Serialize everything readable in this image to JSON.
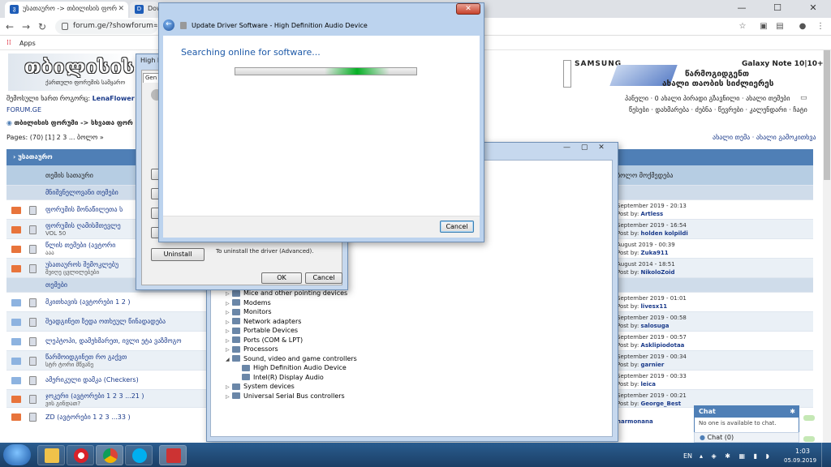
{
  "browser": {
    "tabs": [
      {
        "label": "უსათაურო -> თბილისის ფორ",
        "favicon": "ვ",
        "active": true
      },
      {
        "label": "Dow",
        "favicon": "D",
        "active": false
      }
    ],
    "url": "forum.ge/?showforum=25",
    "bookmarks_label": "Apps"
  },
  "site": {
    "logo": "თბილისის ფორუმი",
    "logo_sub": "ქართული ფორუმის სამყარო",
    "user_line_prefix": "შემოსული ხართ როგორც:",
    "username": "LenaFlower",
    "site_name": "FORUM.GE",
    "breadcrumb": "თბილისის ფორუმი -> სხვათა ფორ",
    "pages": "Pages: (70) [1] 2 3 ... ბოლო »",
    "ad_brand": "SAMSUNG",
    "ad_product": "Galaxy Note 10|10+",
    "ad_line1": "წარმოგიდგენთ",
    "ad_line2": "ახალი თაობის სიძლიერეს",
    "right_nav1": "პანელი · 0 ახალი პირადი გზავნილი · ახალი თემები",
    "right_nav2": "წესები · დახმარება · ძებნა · წევრები · კალენდარი · ჩატი",
    "right_actions": "ახალი თემა · ახალი გამოკითხვა",
    "forum_title": "უსათაურო",
    "col_topic": "თემის სათაური",
    "col_last": "ბოლო მოქმედება"
  },
  "rows": [
    {
      "type": "section",
      "title": "მნიშვნელოვანი თემები"
    },
    {
      "title": "ფორუმის მონაწილეთა ს",
      "sub": "",
      "date": "September 2019 - 20:13",
      "poster": "Artless",
      "alt": false,
      "hot": true
    },
    {
      "title": "ფორუმის ღამისმთევლე",
      "sub": "VOL 50",
      "date": "September 2019 - 16:54",
      "poster": "holden kolpildi",
      "alt": true,
      "hot": true
    },
    {
      "title": "წლის თემები (ავტორი",
      "sub": "ააა",
      "date": "August 2019 - 00:39",
      "poster": "Zuka911",
      "alt": false,
      "hot": true
    },
    {
      "title": "უსათაუროს შემოკლებუ",
      "sub": "შეიღე ცვლილებები",
      "date": "August 2014 - 18:51",
      "poster": "NikoloZoid",
      "alt": true,
      "hot": true
    },
    {
      "type": "section",
      "title": "თემები"
    },
    {
      "title": "მკითხავის (ავტორები 1 2 )",
      "sub": "",
      "date": "September 2019 - 01:01",
      "poster": "livesx11",
      "alt": false,
      "hot": false
    },
    {
      "title": "შეადგინეთ ზედა ოთხეულ წინადადება",
      "sub": "",
      "date": "September 2019 - 00:58",
      "poster": "salosuga",
      "alt": true,
      "hot": false
    },
    {
      "title": "ლეპტოპი, დამეხმარეთ, ივლი ეტა ვაზმოგო",
      "sub": "",
      "date": "September 2019 - 00:57",
      "poster": "Asklipiodotaa",
      "alt": false,
      "hot": false
    },
    {
      "title": "წარმოიდგინეთ რო გაქვთ",
      "sub": "სტრ ტორი მწვანე",
      "date": "September 2019 - 00:34",
      "poster": "garnier",
      "alt": true,
      "hot": false
    },
    {
      "title": "ამერიკული დამკა (Checkers)",
      "sub": "",
      "date": "September 2019 - 00:33",
      "poster": "leica",
      "alt": false,
      "hot": false
    },
    {
      "title": "ჯოკერი (ავტორები 1 2 3 ...21 )",
      "sub": "ვის გინდათ?",
      "date": "September 2019 - 00:21",
      "poster": "George_Best",
      "alt": true,
      "hot": true
    },
    {
      "title": "ZD (ავტორები 1 2 3 ...33 )",
      "sub": "",
      "date": "",
      "poster": "narmonana",
      "alt": false,
      "hot": true
    }
  ],
  "chat": {
    "title": "Chat",
    "status": "No one is available to chat.",
    "footer": "Chat (0)"
  },
  "device_manager": {
    "items": [
      {
        "label": "Mice and other pointing devices",
        "indent": 0,
        "expanded": false
      },
      {
        "label": "Modems",
        "indent": 0,
        "expanded": false
      },
      {
        "label": "Monitors",
        "indent": 0,
        "expanded": false
      },
      {
        "label": "Network adapters",
        "indent": 0,
        "expanded": false
      },
      {
        "label": "Portable Devices",
        "indent": 0,
        "expanded": false
      },
      {
        "label": "Ports (COM & LPT)",
        "indent": 0,
        "expanded": false
      },
      {
        "label": "Processors",
        "indent": 0,
        "expanded": false
      },
      {
        "label": "Sound, video and game controllers",
        "indent": 0,
        "expanded": true
      },
      {
        "label": "High Definition Audio Device",
        "indent": 1,
        "expanded": false
      },
      {
        "label": "Intel(R) Display Audio",
        "indent": 1,
        "expanded": false
      },
      {
        "label": "System devices",
        "indent": 0,
        "expanded": false
      },
      {
        "label": "Universal Serial Bus controllers",
        "indent": 0,
        "expanded": false
      }
    ]
  },
  "properties": {
    "title_fragment": "High D",
    "tab_fragment": "Gen",
    "uninstall_label": "Uninstall",
    "uninstall_desc": "To uninstall the driver (Advanced).",
    "ok_label": "OK",
    "cancel_label": "Cancel"
  },
  "update_dialog": {
    "title": "Update Driver Software - High Definition Audio Device",
    "status": "Searching online for software...",
    "cancel_label": "Cancel"
  },
  "taskbar": {
    "lang": "EN",
    "time": "1:03",
    "date": "05.09.2019"
  },
  "colors": {
    "forum_blue": "#4f7fb6",
    "dialog_text_blue": "#1e5aa8",
    "progress_green": "#06b025"
  }
}
